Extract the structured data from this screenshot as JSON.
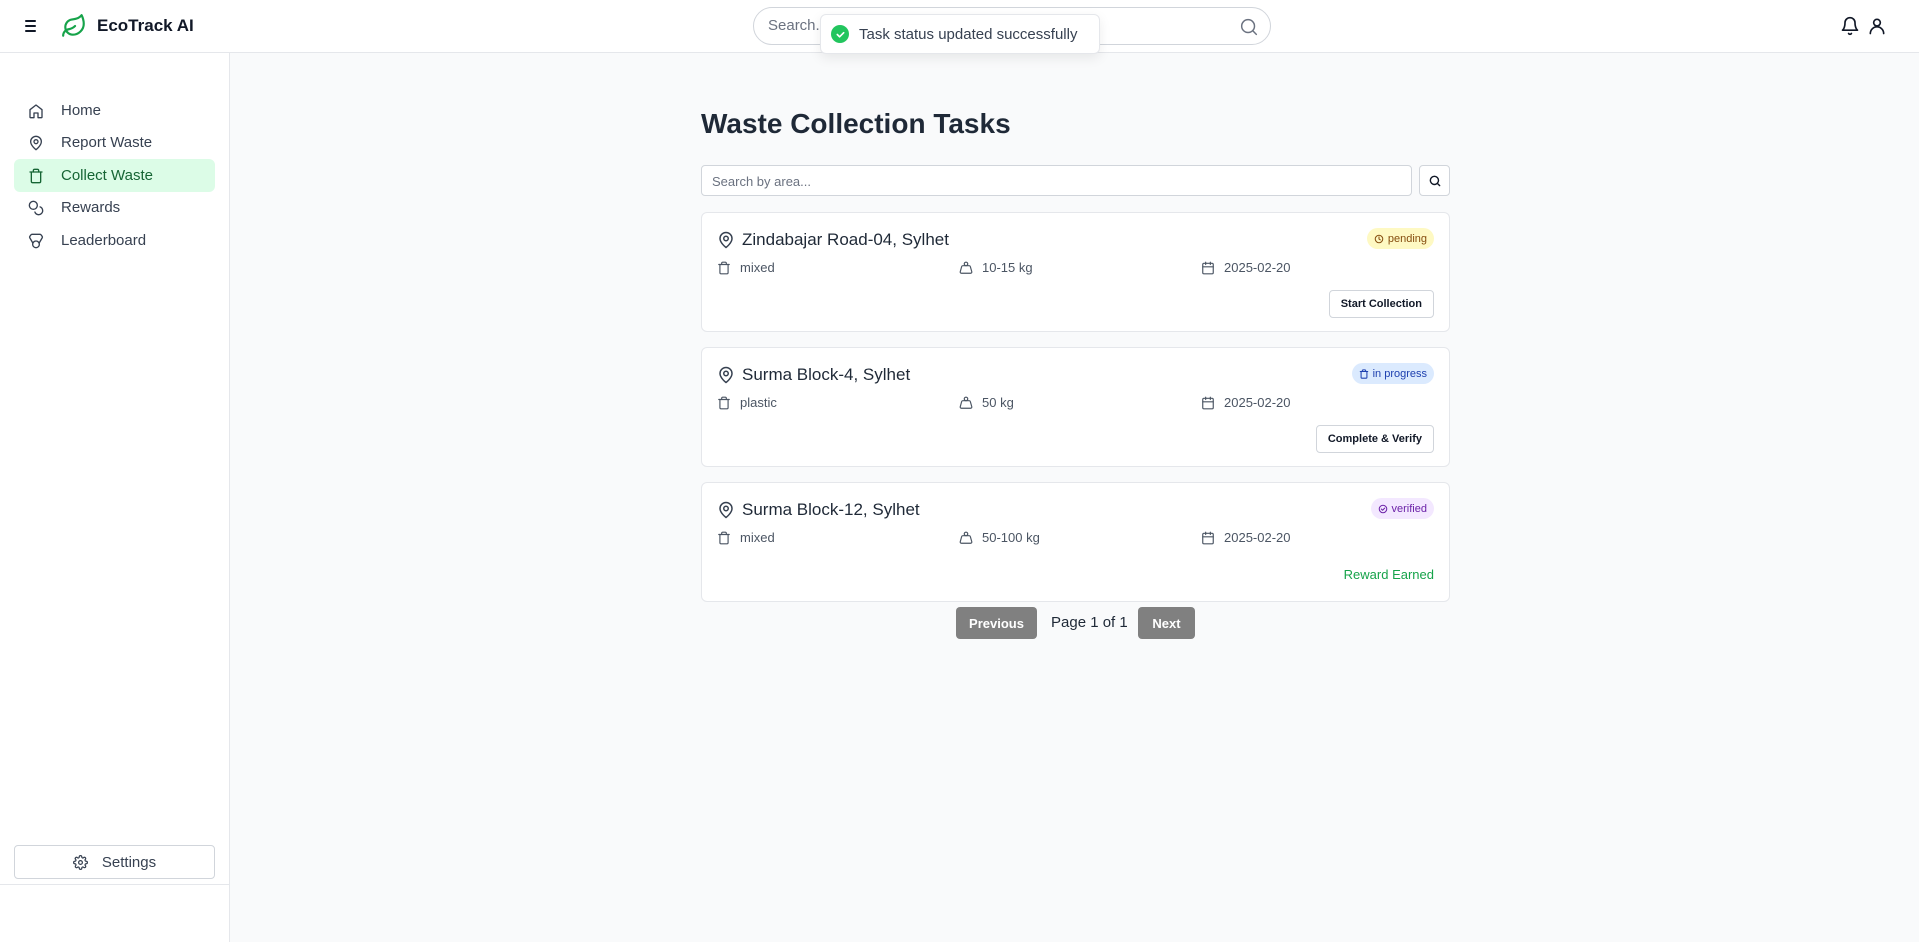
{
  "app": {
    "title": "EcoTrack AI"
  },
  "header": {
    "search_placeholder": "Search...",
    "toast": "Task status updated successfully"
  },
  "sidebar": {
    "items": [
      {
        "label": "Home",
        "icon": "home-icon",
        "active": false
      },
      {
        "label": "Report Waste",
        "icon": "map-pin-icon",
        "active": false
      },
      {
        "label": "Collect Waste",
        "icon": "trash-icon",
        "active": true
      },
      {
        "label": "Rewards",
        "icon": "coins-icon",
        "active": false
      },
      {
        "label": "Leaderboard",
        "icon": "medal-icon",
        "active": false
      }
    ],
    "settings_label": "Settings"
  },
  "main": {
    "title": "Waste Collection Tasks",
    "search_placeholder": "Search by area...",
    "tasks": [
      {
        "location": "Zindabajar Road-04, Sylhet",
        "status": "pending",
        "waste_type": "mixed",
        "amount": "10-15 kg",
        "date": "2025-02-20",
        "action": "Start Collection"
      },
      {
        "location": "Surma Block-4, Sylhet",
        "status": "in progress",
        "waste_type": "plastic",
        "amount": "50 kg",
        "date": "2025-02-20",
        "action": "Complete & Verify"
      },
      {
        "location": "Surma Block-12, Sylhet",
        "status": "verified",
        "waste_type": "mixed",
        "amount": "50-100 kg",
        "date": "2025-02-20",
        "action": "Reward Earned"
      }
    ],
    "pagination": {
      "previous": "Previous",
      "page_text": "Page 1 of 1",
      "next": "Next"
    }
  },
  "colors": {
    "brand": "#16a34a",
    "active_bg": "#dcfce7",
    "pager_bg": "#808080"
  }
}
